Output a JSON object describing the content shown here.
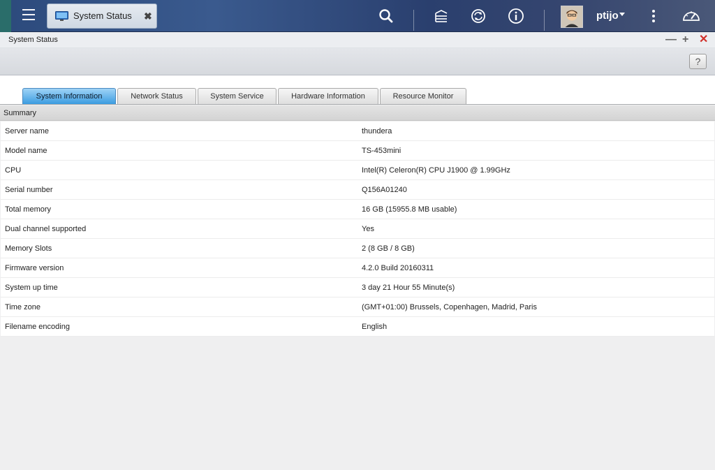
{
  "topbar": {
    "tab_title": "System Status",
    "username": "ptijo",
    "icons": [
      "menu-icon",
      "monitor-icon",
      "close-icon",
      "search-icon",
      "task-stack-icon",
      "sync-icon",
      "info-icon",
      "more-icon",
      "dashboard-gauge-icon"
    ]
  },
  "window": {
    "title": "System Status",
    "help_label": "?"
  },
  "tabs": [
    {
      "label": "System Information",
      "active": true
    },
    {
      "label": "Network Status",
      "active": false
    },
    {
      "label": "System Service",
      "active": false
    },
    {
      "label": "Hardware Information",
      "active": false
    },
    {
      "label": "Resource Monitor",
      "active": false
    }
  ],
  "summary": {
    "header": "Summary",
    "rows": [
      {
        "key": "Server name",
        "value": "thundera"
      },
      {
        "key": "Model name",
        "value": "TS-453mini"
      },
      {
        "key": "CPU",
        "value": "Intel(R) Celeron(R) CPU J1900 @ 1.99GHz"
      },
      {
        "key": "Serial number",
        "value": "Q156A01240"
      },
      {
        "key": "Total memory",
        "value": "16 GB (15955.8 MB usable)"
      },
      {
        "key": "Dual channel supported",
        "value": "Yes"
      },
      {
        "key": "Memory Slots",
        "value": "2 (8 GB / 8 GB)"
      },
      {
        "key": "Firmware version",
        "value": "4.2.0 Build 20160311"
      },
      {
        "key": "System up time",
        "value": "3 day 21 Hour 55 Minute(s)"
      },
      {
        "key": "Time zone",
        "value": "(GMT+01:00) Brussels, Copenhagen, Madrid, Paris"
      },
      {
        "key": "Filename encoding",
        "value": "English"
      }
    ]
  },
  "colors": {
    "active_tab": "#3b9ce0",
    "close_red": "#d0302a"
  }
}
